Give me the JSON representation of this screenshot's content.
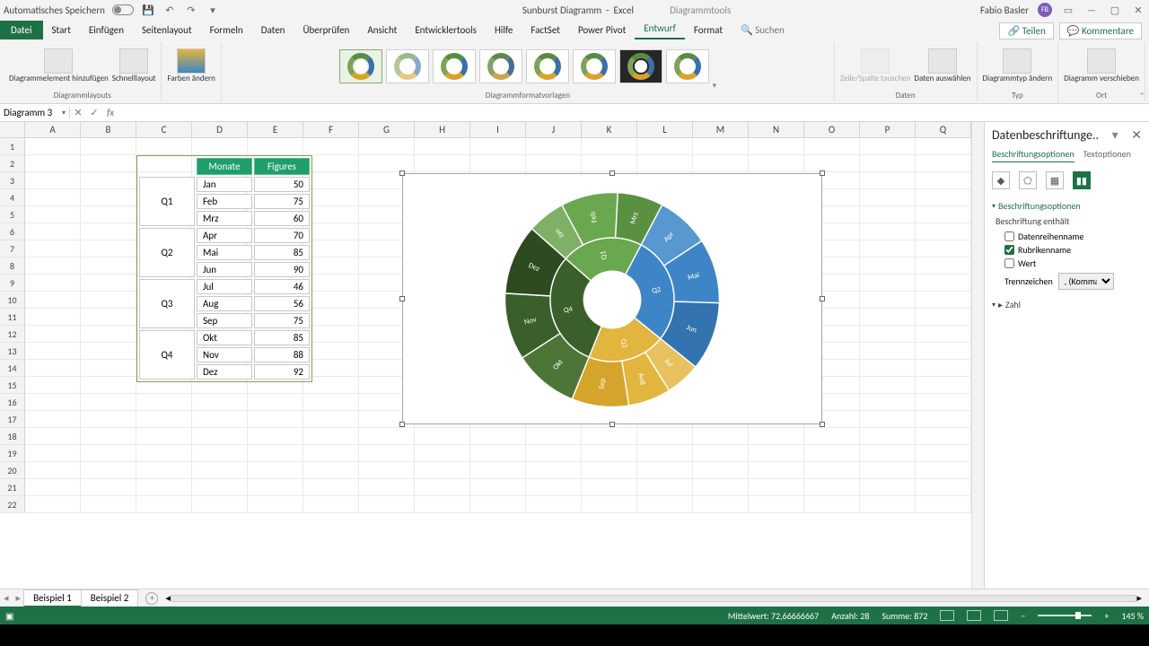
{
  "title_doc": "Sunburst Diagramm",
  "title_app": "Excel",
  "title_tools": "Diagrammtools",
  "autosave_label": "Automatisches Speichern",
  "user_name": "Fabio Basler",
  "user_initials": "FB",
  "tabs": [
    "Datei",
    "Start",
    "Einfügen",
    "Seitenlayout",
    "Formeln",
    "Daten",
    "Überprüfen",
    "Ansicht",
    "Entwicklertools",
    "Hilfe",
    "FactSet",
    "Power Pivot",
    "Entwurf",
    "Format"
  ],
  "active_tab_index": 12,
  "search_placeholder": "Suchen",
  "share_label": "Teilen",
  "comments_label": "Kommentare",
  "ribbon": {
    "grp_layouts": "Diagrammlayouts",
    "btn_add_element": "Diagrammelement hinzufügen",
    "btn_quicklayout": "Schnelllayout",
    "btn_colors": "Farben ändern",
    "grp_styles": "Diagrammformatvorlagen",
    "grp_data": "Daten",
    "btn_switch": "Zeile/Spalte tauschen",
    "btn_select": "Daten auswählen",
    "grp_type": "Typ",
    "btn_changetype": "Diagrammtyp ändern",
    "grp_loc": "Ort",
    "btn_move": "Diagramm verschieben"
  },
  "namebox": "Diagramm 3",
  "columns": [
    "A",
    "B",
    "C",
    "D",
    "E",
    "F",
    "G",
    "H",
    "I",
    "J",
    "K",
    "L",
    "M",
    "N",
    "O",
    "P",
    "Q"
  ],
  "row_count": 22,
  "table": {
    "hdr_month": "Monate",
    "hdr_fig": "Figures",
    "quarters": [
      "Q1",
      "Q2",
      "Q3",
      "Q4"
    ],
    "rows": [
      {
        "m": "Jan",
        "v": 50
      },
      {
        "m": "Feb",
        "v": 75
      },
      {
        "m": "Mrz",
        "v": 60
      },
      {
        "m": "Apr",
        "v": 70
      },
      {
        "m": "Mai",
        "v": 85
      },
      {
        "m": "Jun",
        "v": 90
      },
      {
        "m": "Jul",
        "v": 46
      },
      {
        "m": "Aug",
        "v": 56
      },
      {
        "m": "Sep",
        "v": 75
      },
      {
        "m": "Okt",
        "v": 85
      },
      {
        "m": "Nov",
        "v": 88
      },
      {
        "m": "Dez",
        "v": 92
      }
    ]
  },
  "chart_data": {
    "type": "pie",
    "subtype": "sunburst",
    "inner_ring": [
      {
        "label": "Q1",
        "color": "#6aa84f",
        "children": [
          "Jan",
          "Feb",
          "Mrz"
        ]
      },
      {
        "label": "Q2",
        "color": "#3d85c6",
        "children": [
          "Apr",
          "Mai",
          "Jun"
        ]
      },
      {
        "label": "Q3",
        "color": "#e2b53e",
        "children": [
          "Jul",
          "Aug",
          "Sep"
        ]
      },
      {
        "label": "Q4",
        "color": "#3a5f2a",
        "children": [
          "Okt",
          "Nov",
          "Dez"
        ]
      }
    ],
    "values": {
      "Jan": 50,
      "Feb": 75,
      "Mrz": 60,
      "Apr": 70,
      "Mai": 85,
      "Jun": 90,
      "Jul": 46,
      "Aug": 56,
      "Sep": 75,
      "Okt": 85,
      "Nov": 88,
      "Dez": 92
    }
  },
  "side": {
    "title": "Datenbeschriftunge..",
    "tab1": "Beschriftungsoptionen",
    "tab2": "Textoptionen",
    "section": "Beschriftungsoptionen",
    "contains": "Beschriftung enthält",
    "opt_series": "Datenreihenname",
    "opt_category": "Rubrikenname",
    "opt_value": "Wert",
    "sep_label": "Trennzeichen",
    "sep_value": ", (Komma)",
    "section_num": "Zahl"
  },
  "sheets": [
    "Beispiel 1",
    "Beispiel 2"
  ],
  "active_sheet": 0,
  "status": {
    "mean_lbl": "Mittelwert:",
    "mean": "72,66666667",
    "count_lbl": "Anzahl:",
    "count": "28",
    "sum_lbl": "Summe:",
    "sum": "872",
    "zoom": "145 %"
  },
  "colors": {
    "accent": "#1e7145"
  }
}
